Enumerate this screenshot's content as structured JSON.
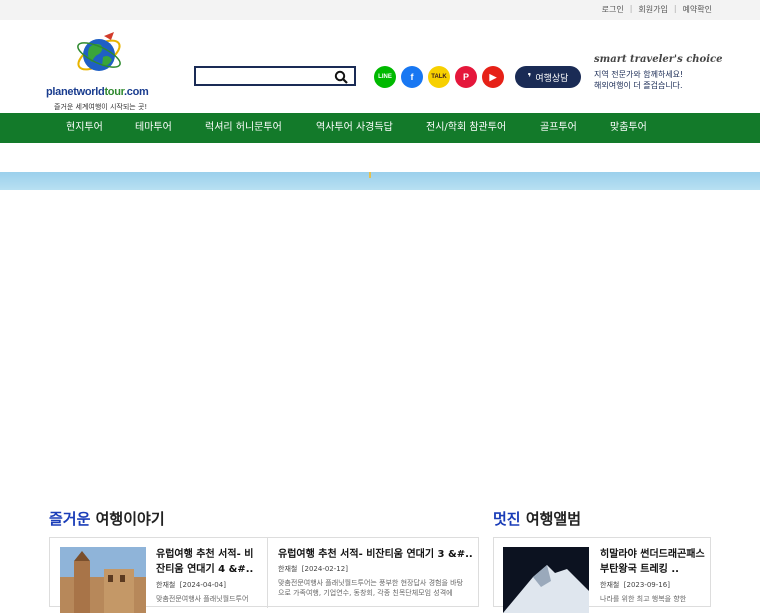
{
  "topbar": {
    "login": "로그인",
    "signup": "회원가입",
    "reservation": "예약확인"
  },
  "logo": {
    "brand_blue": "planetworld",
    "brand_green": "tour",
    "brand_tail": ".com",
    "tagline": "즐거운 세계여행이 시작되는 곳!"
  },
  "search": {
    "placeholder": "",
    "value": ""
  },
  "social": [
    {
      "name": "line-icon",
      "glyph": "LINE",
      "color": "#00b900"
    },
    {
      "name": "facebook-icon",
      "glyph": "f",
      "color": "#1877f2"
    },
    {
      "name": "kakaotalk-icon",
      "glyph": "TALK",
      "color": "#f7d000"
    },
    {
      "name": "kakaostory-icon",
      "glyph": "P",
      "color": "#e5173b"
    },
    {
      "name": "youtube-icon",
      "glyph": "▶",
      "color": "#e62117"
    }
  ],
  "consult": {
    "label": "여행상담"
  },
  "slogan": {
    "script": "smart traveler's choice",
    "line1": "지역 전문가와 함께하세요!",
    "line2": "해외여행이 더 즐겁습니다."
  },
  "nav": [
    "현지투어",
    "테마투어",
    "럭셔리 허니문투어",
    "역사투어 사경득답",
    "전시/학회 참관투어",
    "골프투어",
    "맞춤투어"
  ],
  "stories": {
    "title_accent": "즐거운",
    "title_rest": " 여행이야기",
    "items": [
      {
        "title": "유럽여행 추천 서적- 비잔티움 연대기 4 &#..",
        "author": "한재철",
        "date": "[2024-04-04]",
        "excerpt": "맞춤전문여행사 플래닛월드투어"
      },
      {
        "title": "유럽여행 추천 서적- 비잔티움 연대기 3 &#..",
        "author": "한재철",
        "date": "[2024-02-12]",
        "excerpt": "맞춤전문여행사 플래닛월드투어는 풍부한 현장답사 경험을 바탕으로 가족여행, 기업연수, 동창회, 각종 친목단체모임 성격에"
      }
    ]
  },
  "album": {
    "title_accent": "멋진",
    "title_rest": " 여행앨범",
    "items": [
      {
        "title": "히말라야 썬더드래곤패스 부탄왕국 트레킹 ..",
        "author": "한재철",
        "date": "[2023-09-16]",
        "excerpt": "나라를 위한 최고 행복을 향한"
      }
    ]
  },
  "colors": {
    "nav_green": "#137a2a",
    "navy": "#1a2b55",
    "accent_blue": "#1a3db8"
  }
}
